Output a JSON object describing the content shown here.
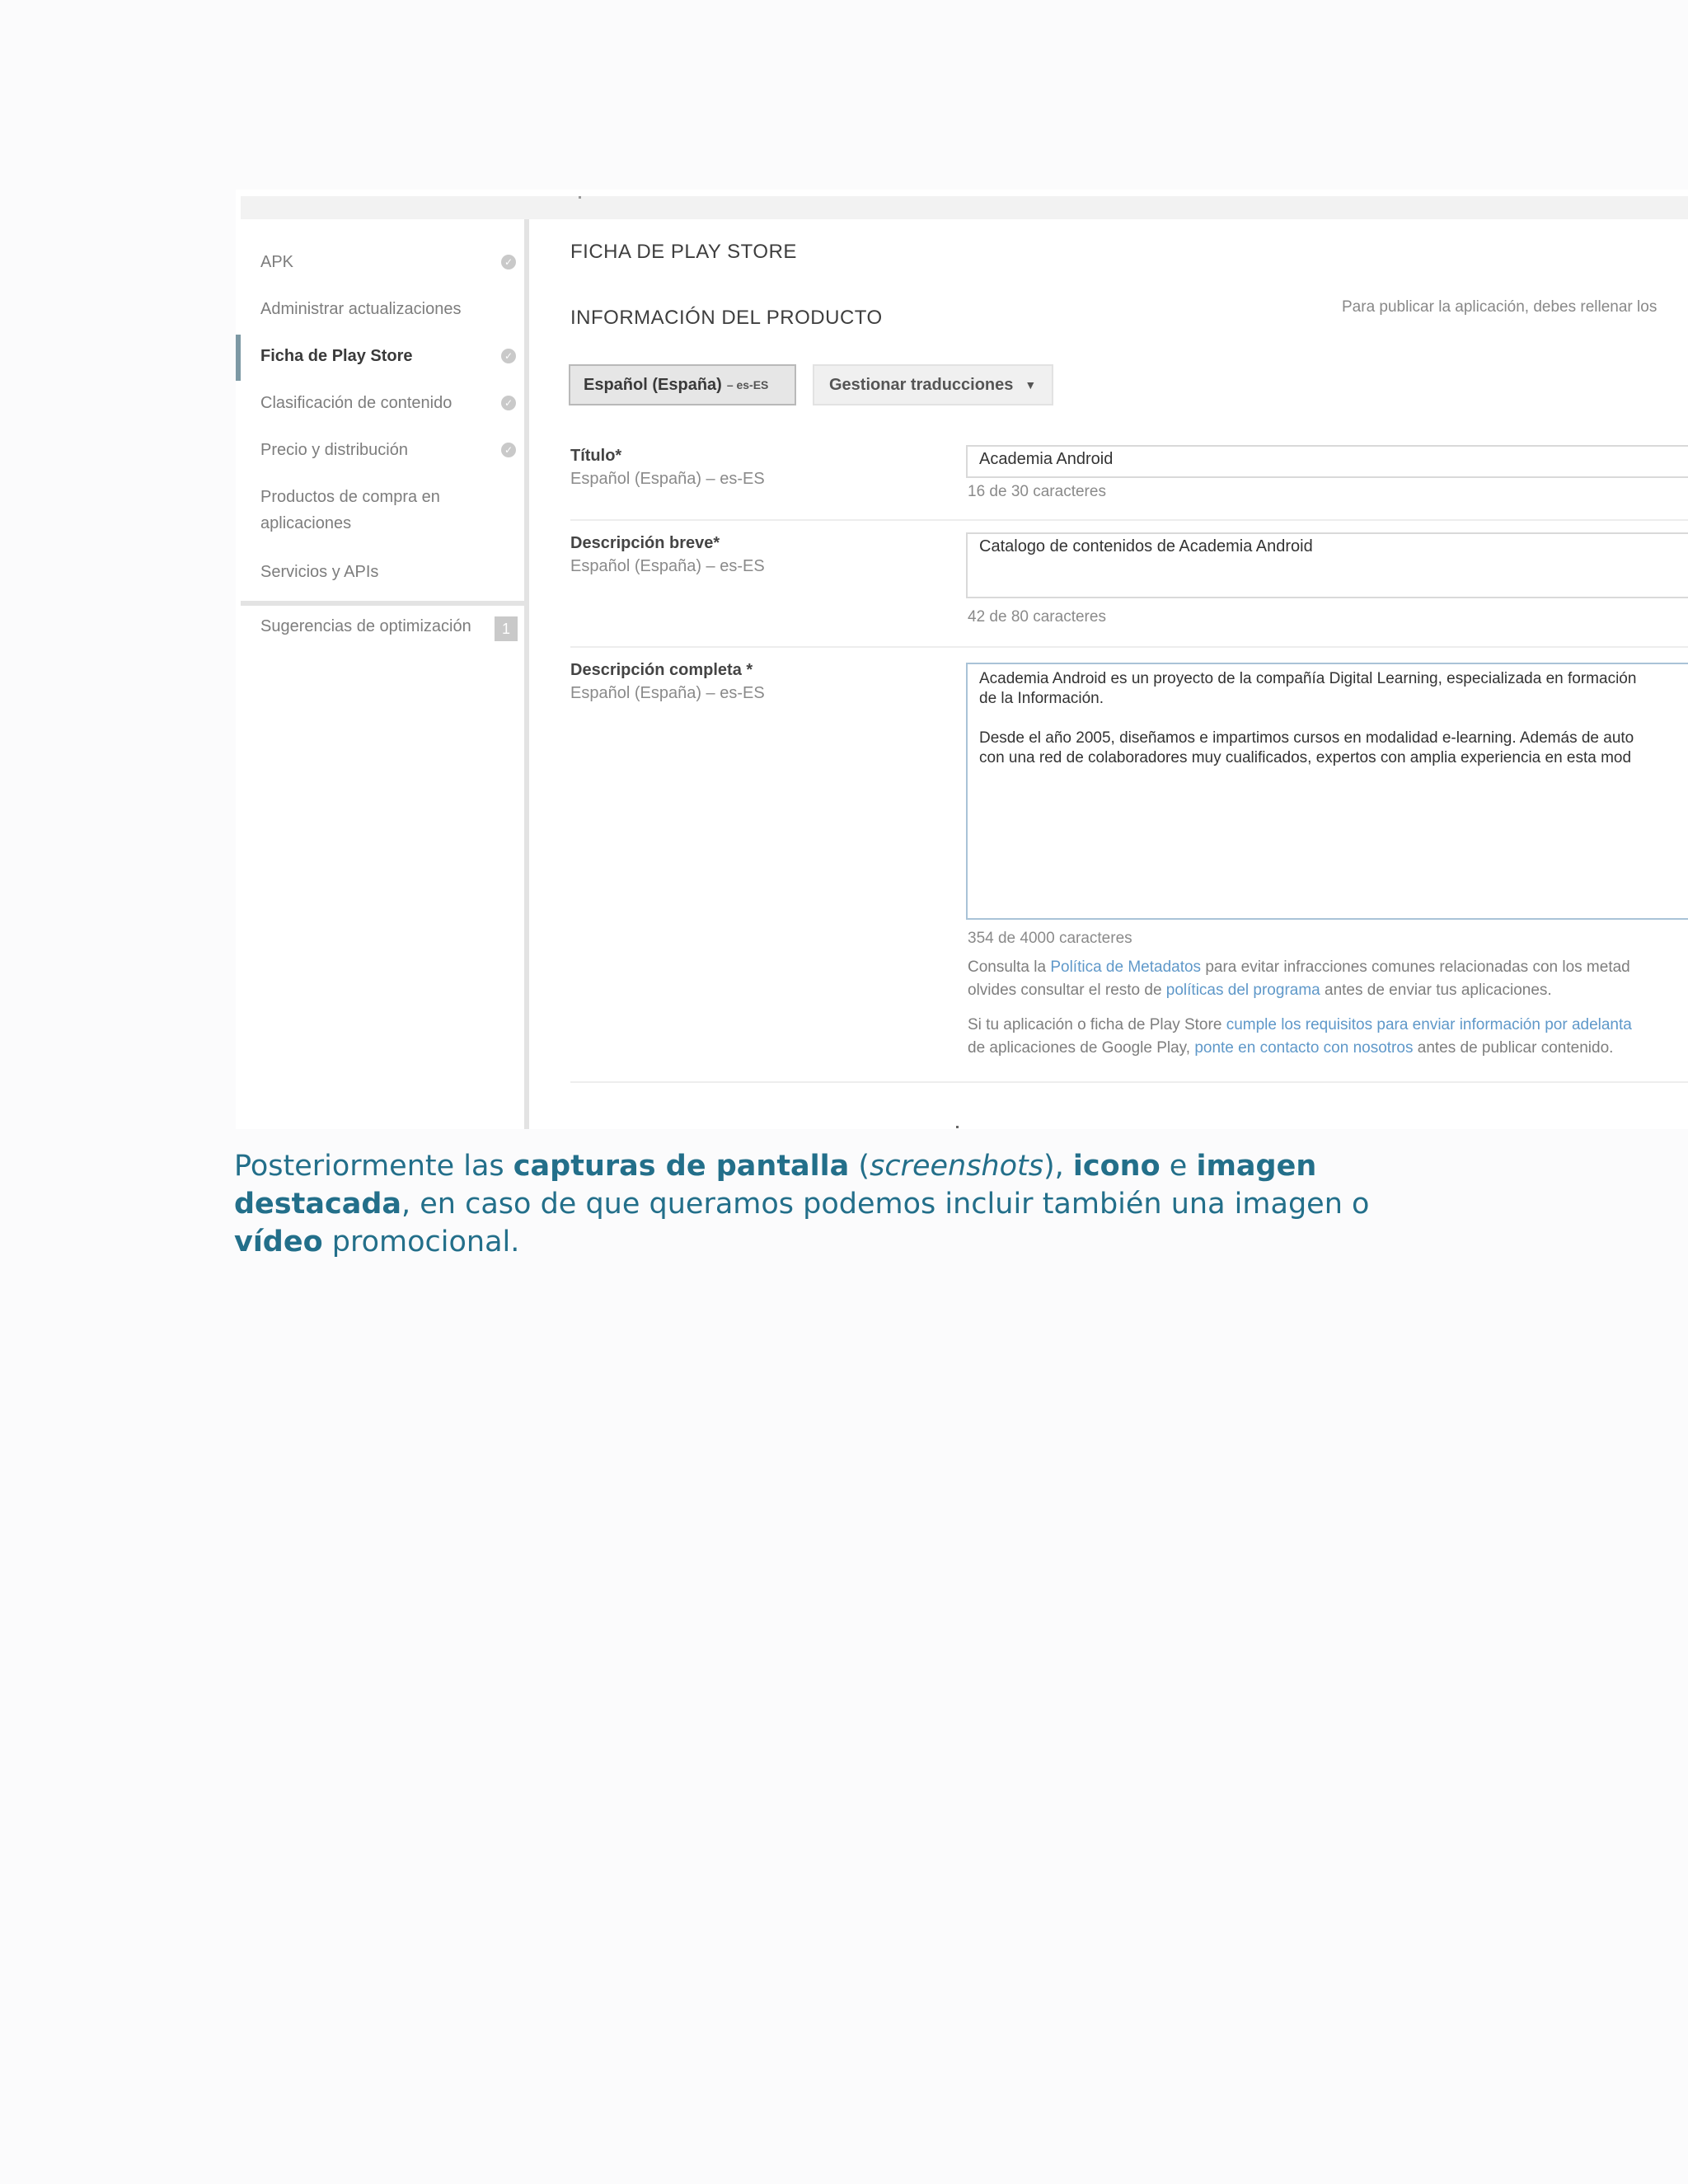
{
  "sidebar": {
    "items": [
      {
        "label": "APK",
        "checked": true
      },
      {
        "label": "Administrar actualizaciones",
        "checked": false
      },
      {
        "label": "Ficha de Play Store",
        "checked": true,
        "active": true
      },
      {
        "label": "Clasificación de contenido",
        "checked": true
      },
      {
        "label": "Precio y distribución",
        "checked": true
      },
      {
        "label_line1": "Productos de compra en",
        "label_line2": "aplicaciones",
        "checked": false
      },
      {
        "label": "Servicios y APIs",
        "checked": false
      }
    ],
    "optimization": {
      "label": "Sugerencias de optimización",
      "badge": "1"
    }
  },
  "main": {
    "page_title": "FICHA DE PLAY STORE",
    "section_title": "INFORMACIÓN DEL PRODUCTO",
    "publish_note": "Para publicar la aplicación, debes rellenar los",
    "language_button": {
      "label": "Español (España)",
      "code": "– es-ES"
    },
    "translations_button": {
      "label": "Gestionar traducciones",
      "caret": "▼"
    },
    "fields": {
      "title": {
        "label": "Título*",
        "language": "Español (España) – es-ES",
        "value": "Academia Android",
        "counter": "16 de 30 caracteres"
      },
      "short_description": {
        "label": "Descripción breve*",
        "language": "Español (España) – es-ES",
        "value": "Catalogo de contenidos de Academia Android",
        "counter": "42 de 80 caracteres"
      },
      "full_description": {
        "label": "Descripción completa *",
        "language": "Español (España) – es-ES",
        "paragraph1_line1": "Academia Android es un proyecto de la compañía Digital Learning, especializada en formación",
        "paragraph1_line2": "de la Información.",
        "paragraph2_line1": "Desde el año 2005, diseñamos e impartimos cursos en modalidad e-learning. Además de auto",
        "paragraph2_line2": "con una red de colaboradores muy cualificados, expertos con amplia experiencia en esta mod",
        "counter": "354 de 4000 caracteres"
      }
    },
    "info1": {
      "pre": "Consulta la ",
      "link1": "Política de Metadatos",
      "mid": " para evitar infracciones comunes relacionadas con los metad",
      "line2_pre": "olvides consultar el resto de ",
      "link2": "políticas del programa",
      "line2_post": " antes de enviar tus aplicaciones."
    },
    "info2": {
      "pre": "Si tu aplicación o ficha de Play Store ",
      "link1": "cumple los requisitos para enviar información por adelanta",
      "line2_pre": "de aplicaciones de Google Play, ",
      "link2": "ponte en contacto con nosotros",
      "line2_post": " antes de publicar contenido."
    }
  },
  "caption": {
    "t1": "Posteriormente las ",
    "b1": "capturas de pantalla",
    "t2": " (",
    "i1": "screenshots",
    "t3": "), ",
    "b2": "icono",
    "t4": " e ",
    "b3": "imagen destacada",
    "t5": ", en caso de que queramos podemos incluir también una imagen o ",
    "b4": "vídeo",
    "t6": " promocional."
  },
  "colors": {
    "caption_text": "#236f8a",
    "link": "#5f98c9",
    "active_indicator": "#7c98a4",
    "desc_box_border": "#a9c3d7"
  }
}
